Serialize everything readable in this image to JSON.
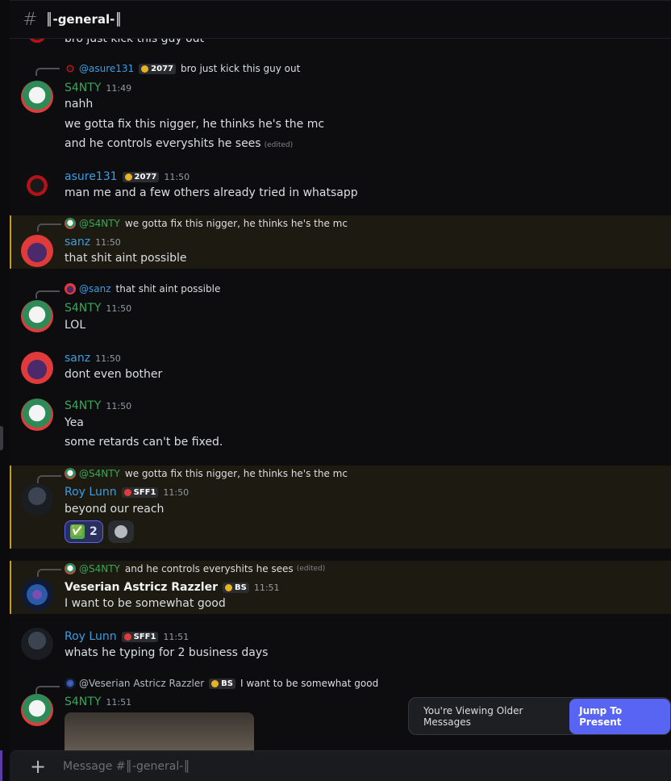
{
  "channel": {
    "title": "║-general-║",
    "hash_icon": "hash-icon"
  },
  "colors": {
    "green_name": "#3ba55c",
    "blue_name": "#3b9ee5",
    "highlight": "#c79a22",
    "accent": "#5865f2"
  },
  "top_cut": {
    "text": "bro just kick this guy out"
  },
  "messages": [
    {
      "reply": {
        "name": "@asure131",
        "badge": "2077",
        "text": "bro just kick this guy out"
      },
      "user": "S4NTY",
      "time": "11:49",
      "lines": [
        "nahh",
        "we gotta fix this nigger, he thinks he's the mc",
        "and he controls everyshits he sees"
      ],
      "edited": "(edited)"
    },
    {
      "user": "asure131",
      "badge": "2077",
      "time": "11:50",
      "lines": [
        "man me and a few others already tried in whatsapp"
      ]
    },
    {
      "reply": {
        "name": "@S4NTY",
        "text": "we gotta fix this nigger, he thinks he's the mc"
      },
      "user": "sanz",
      "time": "11:50",
      "lines": [
        "that shit aint possible"
      ]
    },
    {
      "reply": {
        "name": "@sanz",
        "text": "that shit aint possible"
      },
      "user": "S4NTY",
      "time": "11:50",
      "lines": [
        "LOL"
      ]
    },
    {
      "user": "sanz",
      "time": "11:50",
      "lines": [
        "dont even bother"
      ]
    },
    {
      "user": "S4NTY",
      "time": "11:50",
      "lines": [
        "Yea",
        "some retards can't be fixed."
      ]
    },
    {
      "reply": {
        "name": "@S4NTY",
        "text": "we gotta fix this nigger, he thinks he's the mc"
      },
      "user": "Roy Lunn",
      "badge": "SFF1",
      "time": "11:50",
      "lines": [
        "beyond our reach"
      ],
      "reactions": [
        {
          "emoji": "✅",
          "count": "2"
        }
      ]
    },
    {
      "reply": {
        "name": "@S4NTY",
        "text": "and he controls everyshits he sees",
        "edited": "(edited)"
      },
      "user": "Veserian Astricz Razzler",
      "badge": "BS",
      "time": "11:51",
      "lines": [
        "I want to be somewhat good"
      ]
    },
    {
      "user": "Roy Lunn",
      "badge": "SFF1",
      "time": "11:51",
      "lines": [
        "whats he typing for 2 business days"
      ]
    },
    {
      "reply": {
        "name": "@Veserian Astricz Razzler",
        "badge": "BS",
        "text": "I want to be somewhat good"
      },
      "user": "S4NTY",
      "time": "11:51"
    }
  ],
  "toast": {
    "message": "You're Viewing Older Messages",
    "button": "Jump To Present"
  },
  "composer": {
    "placeholder": "Message #║-general-║"
  }
}
